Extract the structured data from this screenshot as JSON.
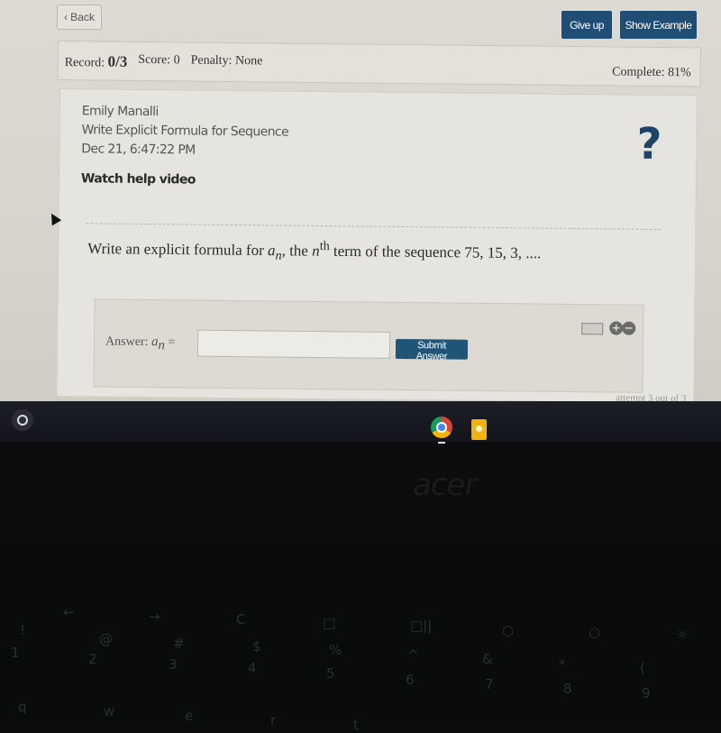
{
  "toolbar": {
    "back_label": "Back",
    "give_up_label": "Give up",
    "show_example_label": "Show Example"
  },
  "record_bar": {
    "record_label": "Record:",
    "record_value": "0/3",
    "score_label": "Score:",
    "score_value": "0",
    "penalty_label": "Penalty:",
    "penalty_value": "None",
    "complete_label": "Complete:",
    "complete_value": "81%"
  },
  "problem": {
    "student_name": "Emily Manalli",
    "assignment_title": "Write Explicit Formula for Sequence",
    "timestamp": "Dec 21, 6:47:22 PM",
    "help_link": "Watch help video",
    "help_icon": "?",
    "question_prefix": "Write an explicit formula for ",
    "question_var": "a",
    "question_sub": "n",
    "question_mid": ", the ",
    "question_n": "n",
    "question_sup": "th",
    "question_suffix": " term of the sequence 75, 15, 3, ...."
  },
  "answer": {
    "label": "Answer:",
    "var": "a",
    "sub": "n",
    "equals": "=",
    "input_value": "",
    "submit_label": "Submit Answer",
    "attempt_text": "attempt 3 out of 3"
  },
  "shelf": {
    "apps": [
      "chrome-icon",
      "google-keep-icon"
    ]
  },
  "bezel": {
    "logo": "acer"
  },
  "keyboard": {
    "keys": [
      "←",
      "→",
      "C",
      "□",
      "□||",
      "○",
      "○",
      "☼",
      "!",
      "@",
      "#",
      "$",
      "%",
      "^",
      "&",
      "*",
      "(",
      "1",
      "2",
      "3",
      "4",
      "5",
      "6",
      "7",
      "8",
      "9",
      "q",
      "w",
      "e",
      "r",
      "t"
    ]
  }
}
